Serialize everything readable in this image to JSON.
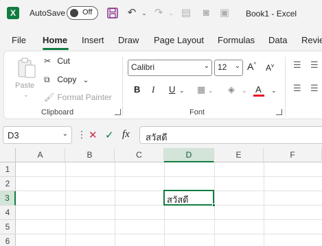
{
  "titlebar": {
    "app_logo": "X",
    "autosave_label": "AutoSave",
    "autosave_state": "Off",
    "doc_title": "Book1  -  Excel",
    "icons": [
      "save-icon",
      "undo-icon",
      "redo-icon",
      "form-icon",
      "camera-icon",
      "screenshot-icon"
    ]
  },
  "tabs": [
    {
      "label": "File"
    },
    {
      "label": "Home",
      "active": true
    },
    {
      "label": "Insert"
    },
    {
      "label": "Draw"
    },
    {
      "label": "Page Layout"
    },
    {
      "label": "Formulas"
    },
    {
      "label": "Data"
    },
    {
      "label": "Revie"
    }
  ],
  "ribbon": {
    "clipboard": {
      "paste_label": "Paste",
      "cut_label": "Cut",
      "copy_label": "Copy",
      "format_painter_label": "Format Painter",
      "group_label": "Clipboard"
    },
    "font": {
      "font_name": "Calibri",
      "font_size": "12",
      "grow_label": "A",
      "shrink_label": "A",
      "bold_label": "B",
      "italic_label": "I",
      "underline_label": "U",
      "font_color_label": "A",
      "group_label": "Font"
    }
  },
  "formula_bar": {
    "name_box": "D3",
    "fx_label": "fx",
    "value": "สวัสดี"
  },
  "grid": {
    "columns": [
      "A",
      "B",
      "C",
      "D",
      "E",
      "F"
    ],
    "rows": [
      "1",
      "2",
      "3",
      "4",
      "5",
      "6"
    ],
    "selected_column": "D",
    "selected_row": "3",
    "active_cell_value": "สวัสดี"
  },
  "colors": {
    "accent": "#107c41",
    "font_color_bar": "#e81123"
  }
}
